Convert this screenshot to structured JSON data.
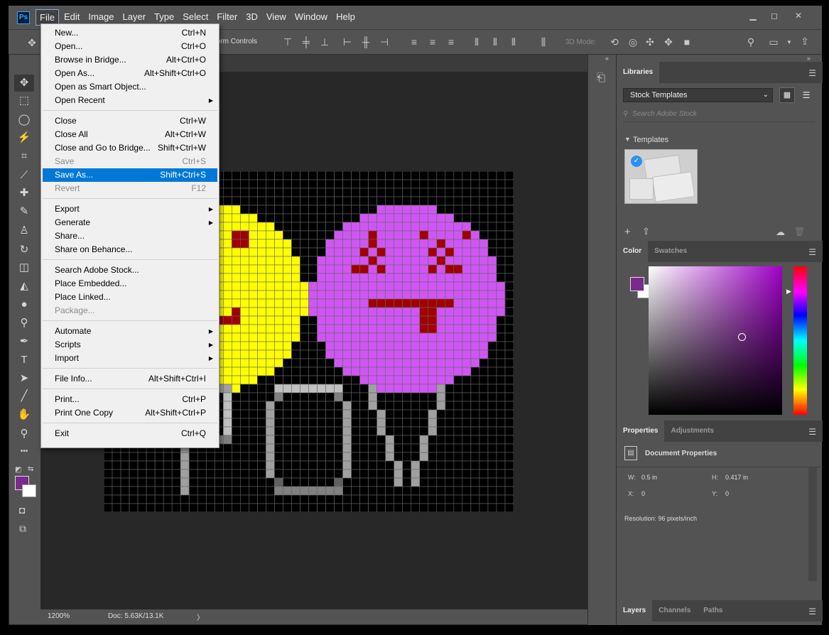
{
  "app": {
    "logo": "Ps"
  },
  "menubar": {
    "items": [
      "File",
      "Edit",
      "Image",
      "Layer",
      "Type",
      "Select",
      "Filter",
      "3D",
      "View",
      "Window",
      "Help"
    ],
    "active": "File",
    "window_buttons": {
      "minimize": "▁",
      "restore": "◻",
      "close": "✕"
    }
  },
  "options_bar": {
    "transform_controls": "form Controls",
    "mode_3d": "3D Mode:"
  },
  "file_menu": {
    "groups": [
      [
        {
          "label": "New...",
          "shortcut": "Ctrl+N",
          "underline": "N"
        },
        {
          "label": "Open...",
          "shortcut": "Ctrl+O",
          "underline": "O"
        },
        {
          "label": "Browse in Bridge...",
          "shortcut": "Alt+Ctrl+O",
          "underline": "B"
        },
        {
          "label": "Open As...",
          "shortcut": "Alt+Shift+Ctrl+O"
        },
        {
          "label": "Open as Smart Object..."
        },
        {
          "label": "Open Recent",
          "submenu": true
        }
      ],
      [
        {
          "label": "Close",
          "shortcut": "Ctrl+W"
        },
        {
          "label": "Close All",
          "shortcut": "Alt+Ctrl+W"
        },
        {
          "label": "Close and Go to Bridge...",
          "shortcut": "Shift+Ctrl+W"
        },
        {
          "label": "Save",
          "shortcut": "Ctrl+S",
          "disabled": true
        },
        {
          "label": "Save As...",
          "shortcut": "Shift+Ctrl+S",
          "highlighted": true
        },
        {
          "label": "Revert",
          "shortcut": "F12",
          "disabled": true
        }
      ],
      [
        {
          "label": "Export",
          "submenu": true
        },
        {
          "label": "Generate",
          "submenu": true
        },
        {
          "label": "Share..."
        },
        {
          "label": "Share on Behance..."
        }
      ],
      [
        {
          "label": "Search Adobe Stock..."
        },
        {
          "label": "Place Embedded..."
        },
        {
          "label": "Place Linked..."
        },
        {
          "label": "Package...",
          "disabled": true
        }
      ],
      [
        {
          "label": "Automate",
          "submenu": true
        },
        {
          "label": "Scripts",
          "submenu": true
        },
        {
          "label": "Import",
          "submenu": true
        }
      ],
      [
        {
          "label": "File Info...",
          "shortcut": "Alt+Shift+Ctrl+I"
        }
      ],
      [
        {
          "label": "Print...",
          "shortcut": "Ctrl+P"
        },
        {
          "label": "Print One Copy",
          "shortcut": "Alt+Shift+Ctrl+P"
        }
      ],
      [
        {
          "label": "Exit",
          "shortcut": "Ctrl+Q"
        }
      ]
    ]
  },
  "toolbar": {
    "tools": [
      "move-tool",
      "marquee-tool",
      "lasso-tool",
      "magic-wand-tool",
      "crop-tool",
      "eyedropper-tool",
      "healing-brush-tool",
      "brush-tool",
      "clone-stamp-tool",
      "history-brush-tool",
      "eraser-tool",
      "paint-bucket-tool",
      "blur-tool",
      "dodge-tool",
      "pen-tool",
      "type-tool",
      "path-selection-tool",
      "line-tool",
      "hand-tool",
      "zoom-tool",
      "more-tools"
    ],
    "foreground_color": "#7a2a8a",
    "background_color": "#ffffff"
  },
  "status": {
    "zoom": "1200%",
    "doc": "Doc: 5.63K/13.1K",
    "arrow": "〉"
  },
  "libraries": {
    "tab": "Libraries",
    "dropdown": "Stock Templates",
    "search_placeholder": "Search Adobe Stock",
    "section": "Templates"
  },
  "color_panel": {
    "tabs": [
      "Color",
      "Swatches"
    ],
    "hue_color": "#a000c8",
    "foreground": "#7a2a8a"
  },
  "properties": {
    "tabs": [
      "Properties",
      "Adjustments"
    ],
    "title": "Document Properties",
    "w_label": "W:",
    "w": "0.5 in",
    "h_label": "H:",
    "h": "0.417 in",
    "x_label": "X:",
    "x": "0",
    "y_label": "Y:",
    "y": "0",
    "resolution": "Resolution: 96 pixels/inch"
  },
  "layers_tabs": [
    "Layers",
    "Channels",
    "Paths"
  ],
  "canvas_art": {
    "cols": 48,
    "rows": 40,
    "colors": {
      "yellow": "#ffff00",
      "purple": "#d055f5",
      "red": "#a00000",
      "black": "#000000"
    }
  }
}
